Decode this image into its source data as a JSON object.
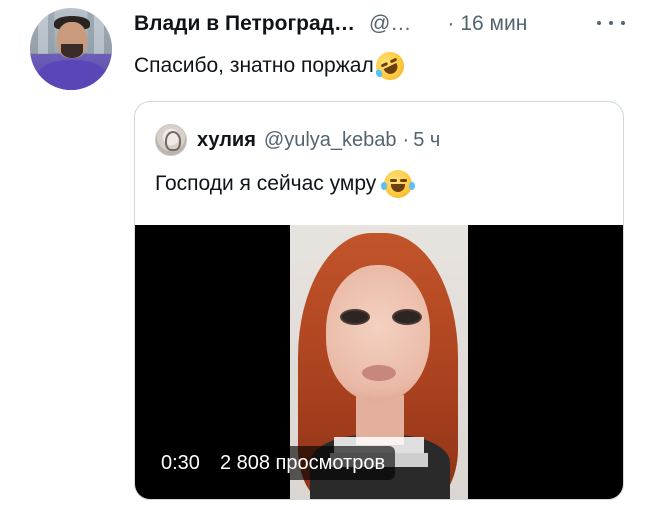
{
  "tweet": {
    "author_name": "Влади в Петроград…",
    "author_handle": "@…",
    "separator": "·",
    "time": "16 мин",
    "text": "Спасибо, знатно поржал",
    "text_emoji": "rolling-on-floor-laughing-emoji"
  },
  "quoted": {
    "author_name": "хулия",
    "author_handle": "@yulya_kebab",
    "separator": "·",
    "time": "5 ч",
    "text": "Господи я сейчас умру",
    "text_emoji": "tears-of-joy-emoji",
    "video": {
      "duration": "0:30",
      "views": "2 808 просмотров"
    }
  },
  "colors": {
    "text_primary": "#0f1419",
    "text_secondary": "#536471",
    "border": "#cfd9de",
    "video_bg": "#000000"
  }
}
